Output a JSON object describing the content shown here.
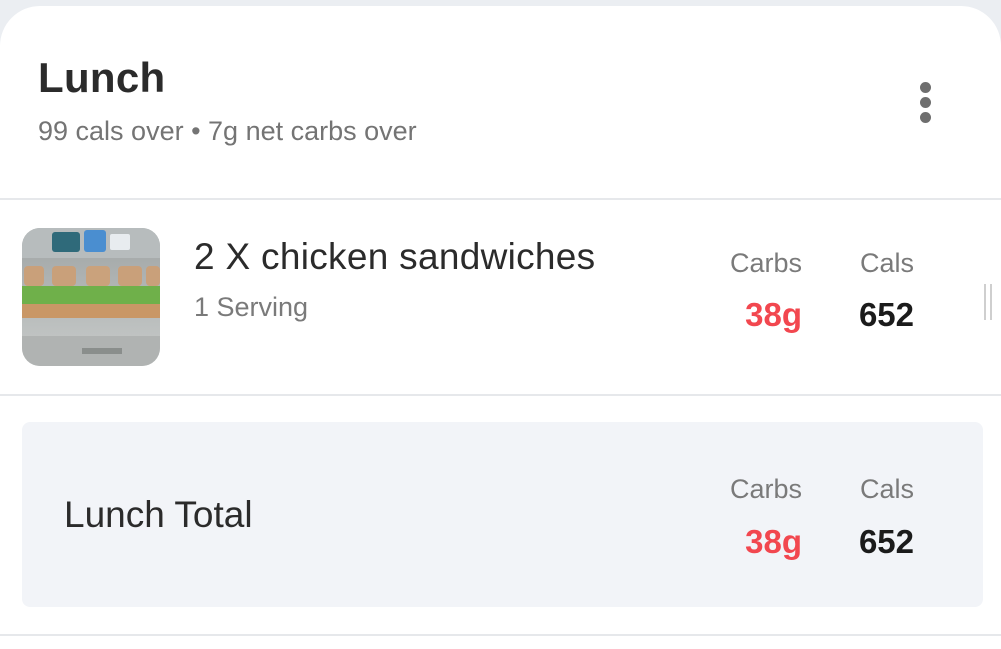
{
  "meal": {
    "title": "Lunch",
    "subtitle": "99 cals over • 7g net carbs over",
    "more_icon": "more-vertical-icon"
  },
  "food_items": [
    {
      "name": "2 X chicken sandwiches",
      "serving": "1 Serving",
      "carbs_label": "Carbs",
      "carbs_value": "38g",
      "cals_label": "Cals",
      "cals_value": "652"
    }
  ],
  "total": {
    "label": "Lunch Total",
    "carbs_label": "Carbs",
    "carbs_value": "38g",
    "cals_label": "Cals",
    "cals_value": "652"
  },
  "colors": {
    "carbs_over": "#f2474f",
    "cals": "#1b1b1b",
    "total_background": "#f2f4f8"
  }
}
